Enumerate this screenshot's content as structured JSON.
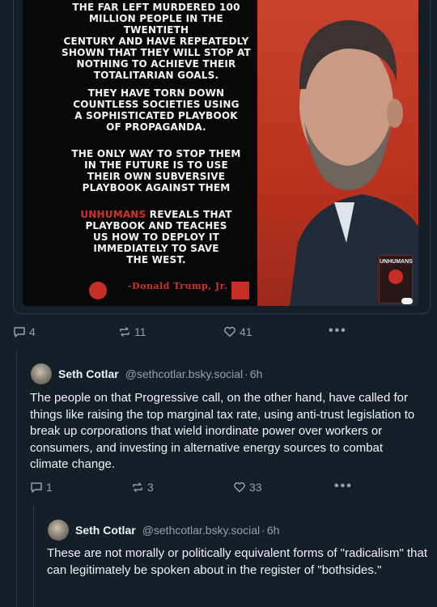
{
  "first_post": {
    "poster": {
      "paragraphs": [
        "The far left murdered 100\nmillion people in the twentieth\ncentury and have repeatedly\nshown that they will stop at\nnothing to achieve their\ntotalitarian goals.",
        "They have torn down\ncountless societies using\na sophisticated playbook\nof propaganda.",
        "The only way to stop them\nin the future is to use\ntheir own subversive\nplaybook against them"
      ],
      "highlight": "Unhumans",
      "last_paragraph": " reveals that\nplaybook and teaches\nus how to deploy it\nimmediately to save\nthe West.",
      "signature": "-Donald Trump, Jr.",
      "book_title": "UNHUMANS"
    },
    "actions": {
      "replies": "4",
      "reposts": "11",
      "likes": "41",
      "more": "•••"
    }
  },
  "reply1": {
    "author_name": "Seth Cotlar",
    "author_handle": "@sethcotlar.bsky.social",
    "time": "6h",
    "text": "The people on that Progressive call, on the other hand, have called for things like raising the top marginal tax rate, using anti-trust legislation to break up corporations that wield inordinate power over workers or consumers, and investing in alternative energy sources to combat climate change.",
    "actions": {
      "replies": "1",
      "reposts": "3",
      "likes": "33",
      "more": "•••"
    }
  },
  "reply2": {
    "author_name": "Seth Cotlar",
    "author_handle": "@sethcotlar.bsky.social",
    "time": "6h",
    "text": "These are not morally or politically equivalent forms of \"radicalism\" that can legitimately be spoken about in the register of \"bothsides.\""
  },
  "colors": {
    "background": "#161e27",
    "text": "#f1f3f5",
    "muted": "#8fa2b6",
    "border": "#2e3a47",
    "poster_red": "#c8432f"
  }
}
